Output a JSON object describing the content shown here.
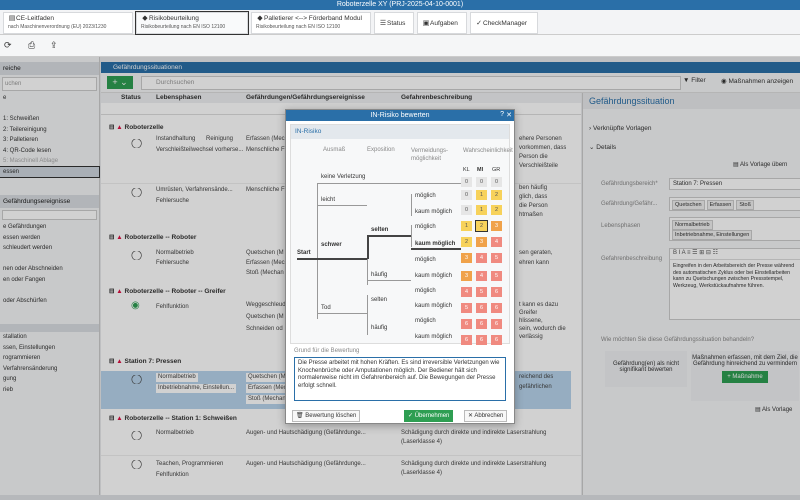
{
  "window_title": "Roboterzelle XY (PRJ-2025-04-10-0001)",
  "tabs": [
    {
      "label": "CE-Leitfaden",
      "sub": "nach Maschinenverordnung (EU) 2023/1230"
    },
    {
      "label": "Risikobeurteilung",
      "sub": "Risikobeurteilung nach EN ISO 12100"
    },
    {
      "label": "Palletierer <--> Förderband Modul",
      "sub": "Risikobeurteilung nach EN ISO 12100"
    },
    {
      "label": "Status"
    },
    {
      "label": "Aufgaben"
    },
    {
      "label": "CheckManager"
    }
  ],
  "left": {
    "section1_title": "reiche",
    "search_placeholder": "uchen",
    "items1": [
      "e",
      "",
      "1: Schweißen",
      "2: Teilereinigung",
      "3: Palletieren",
      "4: QR-Code lesen",
      "5: Maschinell Ablage",
      "essen"
    ],
    "section2_title": "Gefährdungsereignisse",
    "items2": [
      "e Gefährdungen",
      "essen werden",
      "schleudert werden",
      "",
      "nen oder Abschneiden",
      "en oder Fangen",
      "",
      "oder Abschürfen"
    ],
    "items3": [
      "",
      "",
      "stallation",
      "ssen, Einstellungen",
      "rogrammieren",
      "Verfahrensänderung",
      "gung",
      "rieb"
    ]
  },
  "main": {
    "header": "Gefährdungssituationen",
    "search_placeholder": "Durchsuchen",
    "filter_label": "Filter",
    "measures_label": "Maßnahmen anzeigen",
    "columns": [
      "Status",
      "Lebensphasen",
      "Gefährdungen/Gefährdungsereignisse",
      "Gefahrenbeschreibung"
    ],
    "groups": [
      {
        "title": "Roboterzelle",
        "rows": [
          {
            "phase1": "Instandhaltung",
            "phase2": "Reinigung",
            "phase3": "Verschleißteilwechsel vorherse...",
            "haz1": "Erfassen (Mec",
            "haz2": "Menschliche F",
            "desc": "ehere Personen",
            "desc2": "vorkommen, dass",
            "desc3": "Person die",
            "desc4": "Verschleißteile"
          },
          {
            "phase1": "Umrüsten, Verfahrensände...",
            "phase2": "Fehlersuche",
            "haz1": "Menschliche F",
            "desc": "ben häufig",
            "desc2": "glich, dass",
            "desc3": "die Person",
            "desc4": "htmaßen"
          }
        ]
      },
      {
        "title": "Roboterzelle -- Roboter",
        "rows": [
          {
            "phase1": "Normalbetrieb",
            "phase2": "Fehlersuche",
            "haz1": "Quetschen (M",
            "haz2": "Erfassen (Mec",
            "haz3": "Stoß (Mechan",
            "desc": "sen geraten,",
            "desc2": "ehren kann"
          }
        ]
      },
      {
        "title": "Roboterzelle -- Roboter -- Greifer",
        "rows": [
          {
            "phase1": "Fehlfunktion",
            "haz1": "Weggeschleud",
            "haz2": "Quetschen (M",
            "haz3": "Schneiden od",
            "desc": "t kann es dazu",
            "desc2": "Greifer",
            "desc3": "hlissene,",
            "desc4": "sein, wodurch die",
            "desc5": "verlässig"
          }
        ]
      },
      {
        "title": "Station 7: Pressen",
        "rows": [
          {
            "phase1": "Normalbetrieb",
            "phase2": "Inbetriebnahme, Einstellun...",
            "haz1": "Quetschen (M",
            "haz2": "Erfassen (Mec",
            "haz3": "Stoß (Mechan",
            "desc": "reichend des",
            "desc2": "gefährlichen"
          }
        ]
      },
      {
        "title": "Roboterzelle -- Station 1: Schweißen",
        "rows": [
          {
            "phase1": "Normalbetrieb",
            "haz1": "Augen- und Hautschädigung (Gefährdunge...",
            "desc": "Schädigung durch direkte und indirekte Laserstrahlung",
            "desc2": "(Laserklasse 4)"
          },
          {
            "phase1": "Teachen, Programmieren",
            "phase2": "Fehlfunktion",
            "haz1": "Augen- und Hautschädigung (Gefährdunge...",
            "desc": "Schädigung durch direkte und indirekte Laserstrahlung",
            "desc2": "(Laserklasse 4)"
          }
        ]
      }
    ]
  },
  "right": {
    "title": "Gefährdungssituation",
    "linked": "Verknüpfte Vorlagen",
    "details": "Details",
    "as_template": "Als Vorlage übern",
    "area_label": "Gefährdungsbereich*",
    "area_value": "Station 7: Pressen",
    "haz_label": "Gefährdung/Gefähr...",
    "haz_chips": [
      "Quetschen",
      "Erfassen",
      "Stoß"
    ],
    "phase_label": "Lebensphasen",
    "phase_chips": [
      "Normalbetrieb",
      "Inbetriebnahme, Einstellungen"
    ],
    "desc_label": "Gefahrenbeschreibung",
    "desc_text": "Eingreifen in den Arbeitsbereich der Presse während des automatischen Zyklus oder bei Einstellarbeiten kann zu Quetschungen zwischen Pressstempel, Werkzeug, Werkstückaufnahme führen.",
    "question": "Wie möchten Sie diese Gefährdungssituation behandeln?",
    "opt1": "Gefährdung(en) als nicht signifikant bewerten",
    "opt2": "Maßnahmen erfassen, mit dem Ziel, die Gefährdung hinreichend zu vermindern",
    "measure_btn": "Maßnahme",
    "bottom_btn": "Als Vorlage"
  },
  "dialog": {
    "title": "IN-Risiko bewerten",
    "subtitle": "IN-Risiko",
    "col_extent": "Ausmaß",
    "col_exposure": "Exposition",
    "col_avoid": "Vermeidungs-möglichkeit",
    "col_prob": "Wahrscheinlichkeit",
    "prob_heads": [
      "KL",
      "MI",
      "GR"
    ],
    "start": "Start",
    "extent_labels": [
      "keine Verletzung",
      "leicht",
      "schwer",
      "Tod"
    ],
    "exposure_labels": [
      "selten",
      "häufig",
      "selten",
      "häufig"
    ],
    "avoid_labels": [
      "möglich",
      "kaum möglich",
      "möglich",
      "kaum möglich",
      "möglich",
      "kaum möglich",
      "möglich",
      "kaum möglich",
      "möglich",
      "kaum möglich"
    ],
    "matrix": [
      [
        "0",
        "0",
        "0"
      ],
      [
        "0",
        "1",
        "2"
      ],
      [
        "0",
        "1",
        "2"
      ],
      [
        "1",
        "2",
        "3"
      ],
      [
        "2",
        "3",
        "4"
      ],
      [
        "3",
        "4",
        "5"
      ],
      [
        "3",
        "4",
        "5"
      ],
      [
        "4",
        "5",
        "6"
      ],
      [
        "5",
        "6",
        "6"
      ],
      [
        "6",
        "6",
        "6"
      ],
      [
        "6",
        "6",
        "6"
      ]
    ],
    "reason_label": "Grund für die Bewertung",
    "reason_text": "Die Presse arbeitet mit hohen Kräften. Es sind irreversible Verletzungen wie Knochenbrüche oder Amputationen möglich. Der Bediener hält sich normalerweise nicht im Gefahrenbereich auf. Die Bewegungen der Presse erfolgt schnell.",
    "delete_btn": "Bewertung löschen",
    "apply_btn": "Übernehmen",
    "cancel_btn": "Abbrechen"
  }
}
